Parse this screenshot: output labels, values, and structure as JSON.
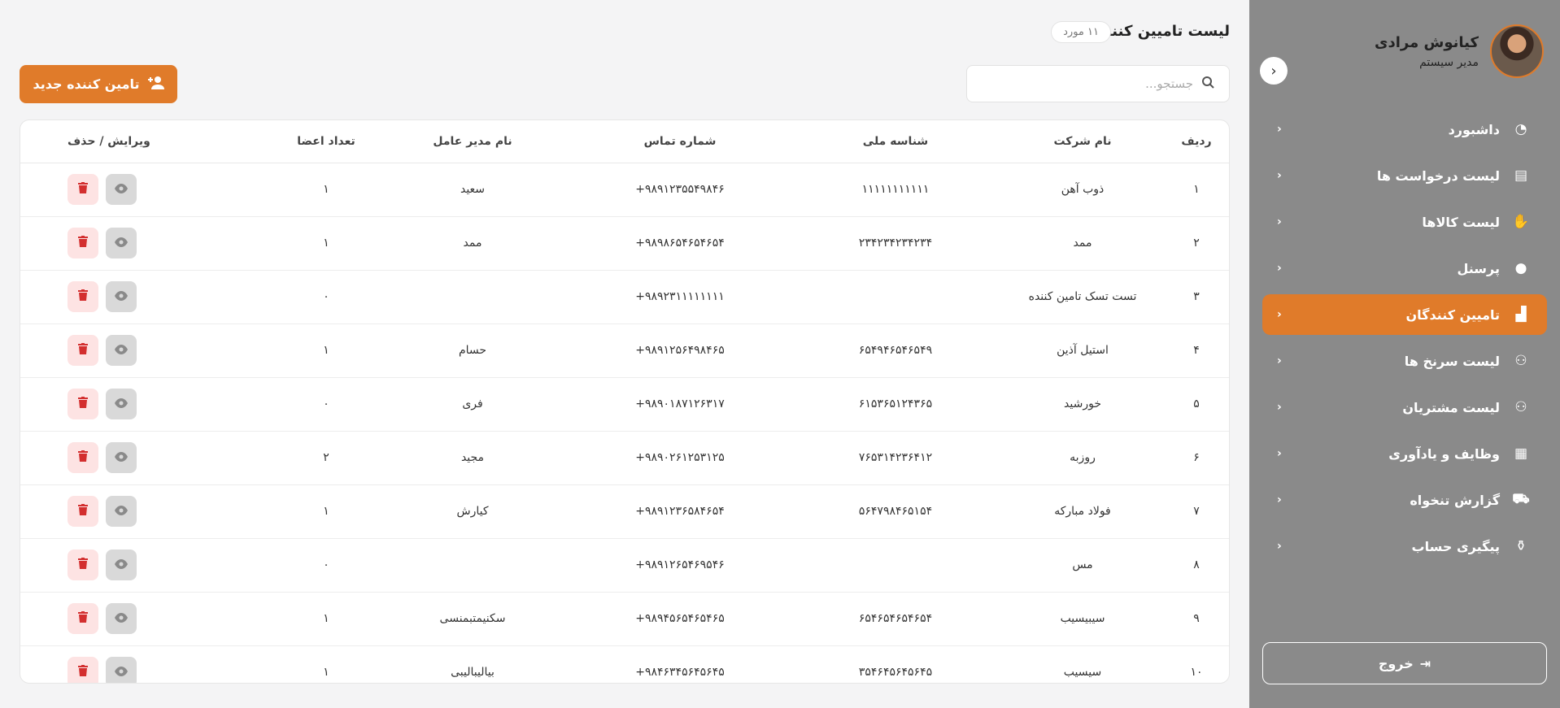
{
  "user": {
    "name": "کیانوش مرادی",
    "role": "مدیر سیستم"
  },
  "sidebar": {
    "items": [
      {
        "label": "داشبورد",
        "icon": "dashboard-icon",
        "glyph": "◔",
        "active": false
      },
      {
        "label": "لیست درخواست ها",
        "icon": "document-icon",
        "glyph": "▤",
        "active": false
      },
      {
        "label": "لیست کالاها",
        "icon": "hand-box-icon",
        "glyph": "✋",
        "active": false
      },
      {
        "label": "پرسنل",
        "icon": "user-icon",
        "glyph": "●",
        "active": false
      },
      {
        "label": "تامیین کنندگان",
        "icon": "factory-icon",
        "glyph": "▟",
        "active": true
      },
      {
        "label": "لیست سرنخ ها",
        "icon": "users-icon",
        "glyph": "⚇",
        "active": false
      },
      {
        "label": "لیست مشتریان",
        "icon": "users-icon",
        "glyph": "⚇",
        "active": false
      },
      {
        "label": "وظایف و یادآوری",
        "icon": "calendar-icon",
        "glyph": "▦",
        "active": false
      },
      {
        "label": "گزارش تنخواه",
        "icon": "cart-icon",
        "glyph": "⛟",
        "active": false
      },
      {
        "label": "پیگیری حساب",
        "icon": "money-bag-icon",
        "glyph": "⚱",
        "active": false
      }
    ],
    "logout_label": "خروج"
  },
  "header": {
    "title": "لیست تامیین کنندگان",
    "count_badge": "۱۱ مورد",
    "search_placeholder": "جستجو...",
    "new_button_label": "تامین کننده جدید"
  },
  "table": {
    "columns": [
      "ردیف",
      "نام شرکت",
      "شناسه ملی",
      "شماره تماس",
      "نام مدیر عامل",
      "تعداد اعضا",
      "ویرایش / حذف"
    ],
    "rows": [
      {
        "idx": "۱",
        "company": "ذوب آهن",
        "national_id": "۱۱۱۱۱۱۱۱۱۱۱",
        "phone": "+۹۸۹۱۲۳۵۵۴۹۸۴۶",
        "manager": "سعید",
        "members": "۱"
      },
      {
        "idx": "۲",
        "company": "ممد",
        "national_id": "۲۳۴۲۳۴۲۳۴۲۳۴",
        "phone": "+۹۸۹۸۶۵۴۶۵۴۶۵۴",
        "manager": "ممد",
        "members": "۱"
      },
      {
        "idx": "۳",
        "company": "تست تسک تامین کننده",
        "national_id": "",
        "phone": "+۹۸۹۲۳۱۱۱۱۱۱۱۱",
        "manager": "",
        "members": "۰"
      },
      {
        "idx": "۴",
        "company": "استیل آذین",
        "national_id": "۶۵۴۹۴۶۵۴۶۵۴۹",
        "phone": "+۹۸۹۱۲۵۶۴۹۸۴۶۵",
        "manager": "حسام",
        "members": "۱"
      },
      {
        "idx": "۵",
        "company": "خورشید",
        "national_id": "۶۱۵۳۶۵۱۲۴۳۶۵",
        "phone": "+۹۸۹۰۱۸۷۱۲۶۳۱۷",
        "manager": "فری",
        "members": "۰"
      },
      {
        "idx": "۶",
        "company": "روزبه",
        "national_id": "۷۶۵۳۱۴۲۳۶۴۱۲",
        "phone": "+۹۸۹۰۲۶۱۲۵۳۱۲۵",
        "manager": "مجید",
        "members": "۲"
      },
      {
        "idx": "۷",
        "company": "فولاد مبارکه",
        "national_id": "۵۶۴۷۹۸۴۶۵۱۵۴",
        "phone": "+۹۸۹۱۲۳۶۵۸۴۶۵۴",
        "manager": "کیارش",
        "members": "۱"
      },
      {
        "idx": "۸",
        "company": "مس",
        "national_id": "",
        "phone": "+۹۸۹۱۲۶۵۴۶۹۵۴۶",
        "manager": "",
        "members": "۰"
      },
      {
        "idx": "۹",
        "company": "سیبیسیب",
        "national_id": "۶۵۴۶۵۴۶۵۴۶۵۴",
        "phone": "+۹۸۹۴۵۶۵۴۶۵۴۶۵",
        "manager": "سکنیمتبمنسی",
        "members": "۱"
      },
      {
        "idx": "۱۰",
        "company": "سیسیب",
        "national_id": "۳۵۴۶۴۵۶۴۵۶۴۵",
        "phone": "+۹۸۴۶۳۴۵۶۴۵۶۴۵",
        "manager": "بیالیبالیبی",
        "members": "۱"
      }
    ]
  },
  "colors": {
    "accent": "#e07b2a",
    "sidebar_bg": "#8a8a8a",
    "delete": "#d32f2f"
  }
}
